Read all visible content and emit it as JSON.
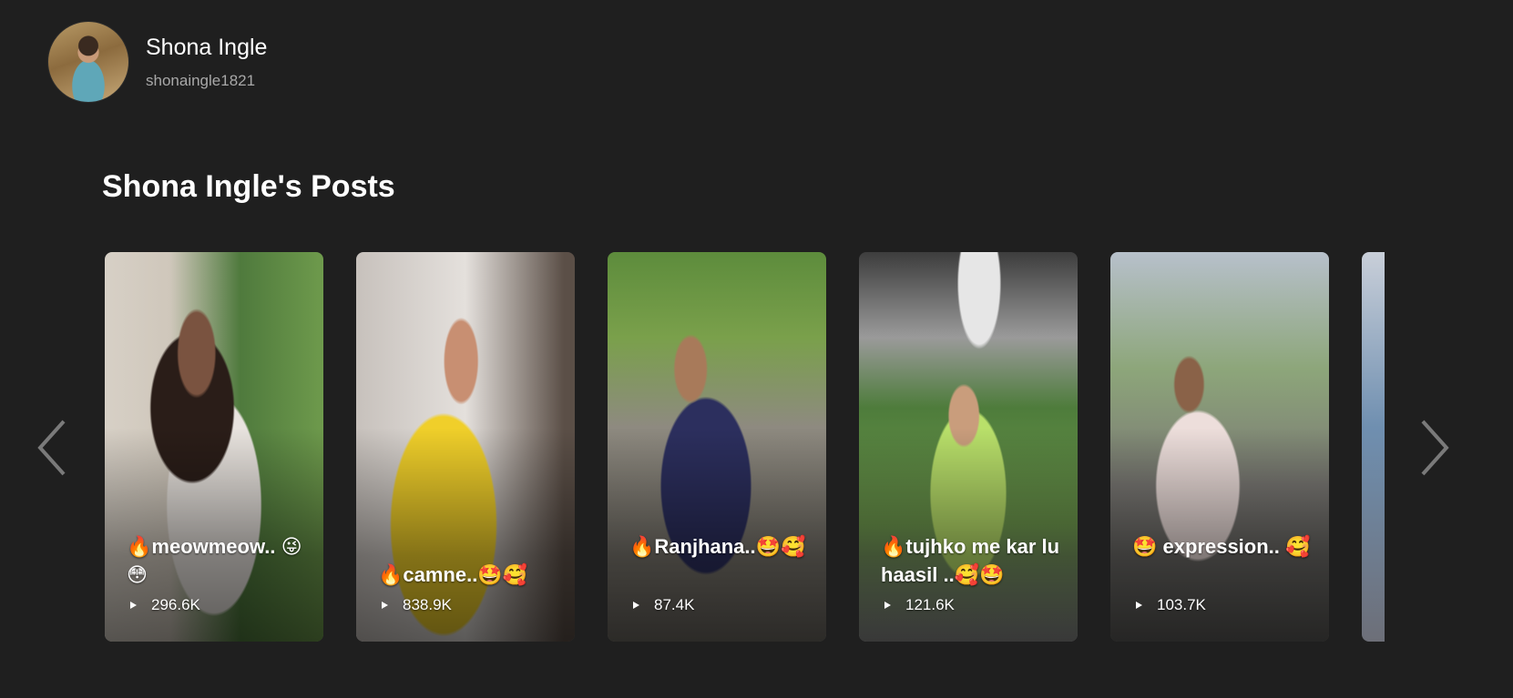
{
  "profile": {
    "name": "Shona Ingle",
    "handle": "shonaingle1821"
  },
  "section": {
    "title": "Shona Ingle's Posts"
  },
  "posts": [
    {
      "caption": "🔥meowmeow.. 😜😳",
      "views": "296.6K"
    },
    {
      "caption": "🔥camne..🤩🥰",
      "views": "838.9K"
    },
    {
      "caption": "🔥Ranjhana..🤩🥰",
      "views": "87.4K"
    },
    {
      "caption": "🔥tujhko me kar lu haasil ..🥰🤩",
      "views": "121.6K"
    },
    {
      "caption": "🤩 expression.. 🥰",
      "views": "103.7K"
    },
    {
      "caption": "",
      "views": ""
    }
  ],
  "icons": {
    "prev": "chevron-left-icon",
    "next": "chevron-right-icon",
    "play": "play-icon"
  }
}
